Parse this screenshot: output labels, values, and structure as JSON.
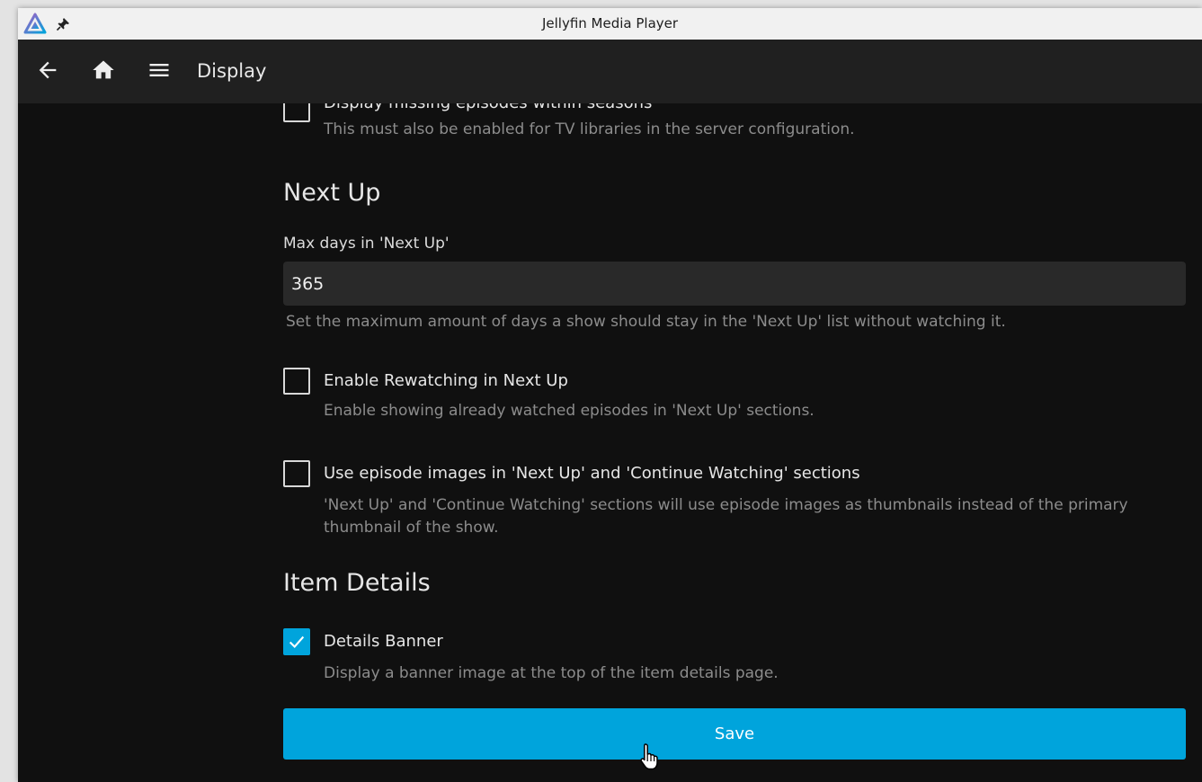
{
  "window": {
    "title": "Jellyfin Media Player"
  },
  "appbar": {
    "title": "Display"
  },
  "partial_option": {
    "label": "Display missing episodes within seasons",
    "description": "This must also be enabled for TV libraries in the server configuration.",
    "checked": false
  },
  "next_up": {
    "heading": "Next Up",
    "max_days_label": "Max days in 'Next Up'",
    "max_days_value": "365",
    "max_days_description": "Set the maximum amount of days a show should stay in the 'Next Up' list without watching it.",
    "rewatching": {
      "label": "Enable Rewatching in Next Up",
      "description": "Enable showing already watched episodes in 'Next Up' sections.",
      "checked": false
    },
    "episode_images": {
      "label": "Use episode images in 'Next Up' and 'Continue Watching' sections",
      "description": "'Next Up' and 'Continue Watching' sections will use episode images as thumbnails instead of the primary thumbnail of the show.",
      "checked": false
    }
  },
  "item_details": {
    "heading": "Item Details",
    "details_banner": {
      "label": "Details Banner",
      "description": "Display a banner image at the top of the item details page.",
      "checked": true
    }
  },
  "save_label": "Save",
  "colors": {
    "accent": "#00a4dc",
    "background": "#101010",
    "appbar": "#202020"
  },
  "icons": [
    "jellyfin-logo",
    "pin-icon",
    "back-arrow-icon",
    "home-icon",
    "menu-icon",
    "checkmark-icon",
    "pointer-cursor-icon"
  ]
}
